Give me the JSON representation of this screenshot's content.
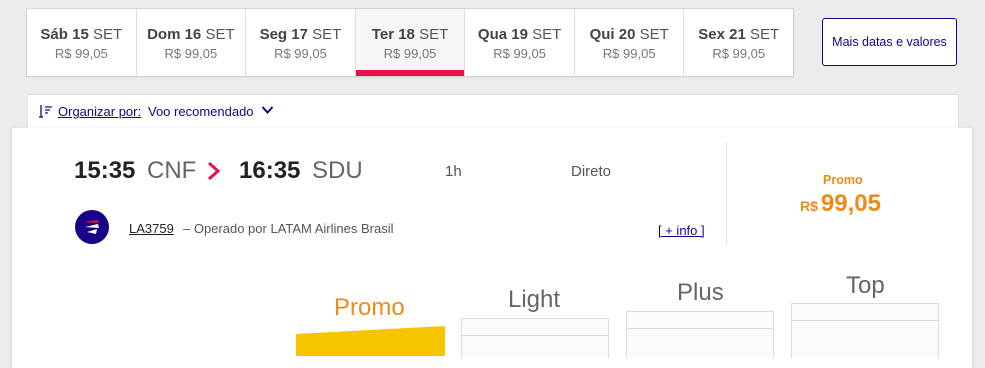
{
  "dates": [
    {
      "day": "Sáb 15",
      "month": "SET",
      "price": "R$ 99,05",
      "active": false
    },
    {
      "day": "Dom 16",
      "month": "SET",
      "price": "R$ 99,05",
      "active": false
    },
    {
      "day": "Seg 17",
      "month": "SET",
      "price": "R$ 99,05",
      "active": false
    },
    {
      "day": "Ter 18",
      "month": "SET",
      "price": "R$ 99,05",
      "active": true
    },
    {
      "day": "Qua 19",
      "month": "SET",
      "price": "R$ 99,05",
      "active": false
    },
    {
      "day": "Qui 20",
      "month": "SET",
      "price": "R$ 99,05",
      "active": false
    },
    {
      "day": "Sex 21",
      "month": "SET",
      "price": "R$ 99,05",
      "active": false
    }
  ],
  "more_dates_label": "Mais datas e valores",
  "sort": {
    "label": "Organizar por:",
    "value": "Voo recomendado"
  },
  "flight": {
    "departure_time": "15:35",
    "departure_code": "CNF",
    "arrival_time": "16:35",
    "arrival_code": "SDU",
    "duration": "1h",
    "stops": "Direto",
    "flight_number": "LA3759",
    "operated_by": "– Operado por LATAM Airlines Brasil",
    "info_link": "[ + info ]",
    "fare_label": "Promo",
    "currency": "R$",
    "price": "99,05"
  },
  "fares": [
    {
      "name": "Promo",
      "color": "#f08a17",
      "selected": true
    },
    {
      "name": "Light",
      "color": "#666666",
      "selected": false
    },
    {
      "name": "Plus",
      "color": "#666666",
      "selected": false
    },
    {
      "name": "Top",
      "color": "#666666",
      "selected": false
    }
  ],
  "colors": {
    "brand": "#1b0088",
    "accent": "#e8114b",
    "promo": "#f08a17",
    "promo_bar": "#f7c400"
  }
}
